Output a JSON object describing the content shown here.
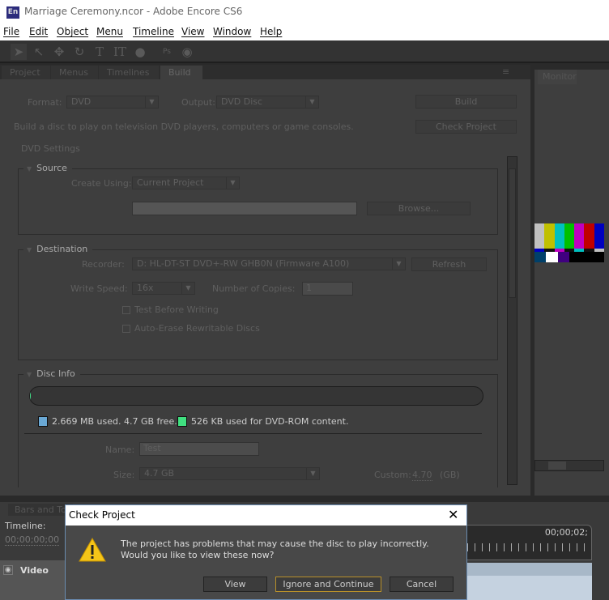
{
  "window": {
    "title": "Marriage Ceremony.ncor - Adobe Encore CS6",
    "app_icon": "En"
  },
  "menu": [
    "File",
    "Edit",
    "Object",
    "Menu",
    "Timeline",
    "View",
    "Window",
    "Help"
  ],
  "tabs": [
    "Project",
    "Menus",
    "Timelines",
    "Build"
  ],
  "build": {
    "format_label": "Format:",
    "format_value": "DVD",
    "output_label": "Output:",
    "output_value": "DVD Disc",
    "build_button": "Build",
    "check_button": "Check Project",
    "description": "Build a disc to play on television DVD players, computers or game consoles.",
    "settings_heading": "DVD Settings",
    "source": {
      "title": "Source",
      "create_using_label": "Create Using:",
      "create_using_value": "Current Project",
      "browse_button": "Browse..."
    },
    "destination": {
      "title": "Destination",
      "recorder_label": "Recorder:",
      "recorder_value": "D: HL-DT-ST DVD+-RW GHB0N (Firmware A100)",
      "refresh_button": "Refresh",
      "write_speed_label": "Write Speed:",
      "write_speed_value": "16x",
      "copies_label": "Number of Copies:",
      "copies_value": "1",
      "test_before_writing": "Test Before Writing",
      "auto_erase": "Auto-Erase Rewritable Discs"
    },
    "disc_info": {
      "title": "Disc Info",
      "used_fraction": 0.001,
      "used_text": "2.669 MB used.  4.7 GB free.",
      "rom_text": "526 KB used for DVD-ROM content.",
      "used_color": "#6aa8d4",
      "rom_color": "#40e080",
      "name_label": "Name:",
      "name_value": "Test",
      "size_label": "Size:",
      "size_value": "4.7 GB",
      "custom_label": "Custom:",
      "custom_value": "4.70",
      "custom_unit": "(GB)"
    }
  },
  "monitor": {
    "tab": "Monitor"
  },
  "bottom": {
    "tab": "Bars and To",
    "timeline_label": "Timeline:",
    "timecode": "00;00;00;00",
    "end_timecode": "00;00;02;",
    "track": "Video"
  },
  "dialog": {
    "title": "Check Project",
    "message": "The project has problems that may cause the disc to play incorrectly. Would you like to view these now?",
    "buttons": [
      "View",
      "Ignore and Continue",
      "Cancel"
    ]
  }
}
